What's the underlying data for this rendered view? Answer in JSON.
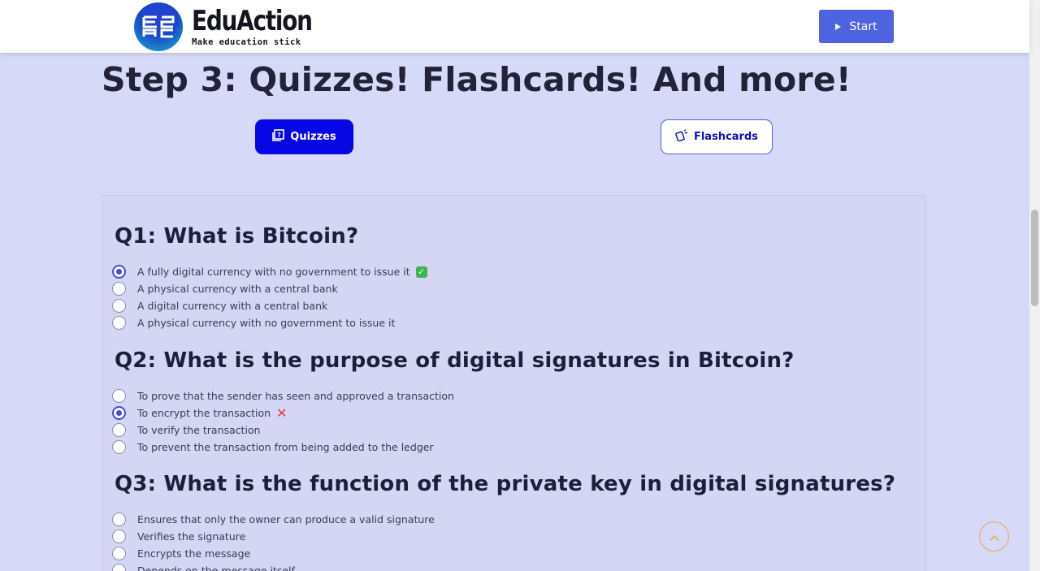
{
  "header": {
    "brand": "EduAction",
    "tagline": "Make education stick",
    "start_label": "Start"
  },
  "step": {
    "title": "Step 3: Quizzes! Flashcards! And more!"
  },
  "tabs": {
    "quizzes_label": "Quizzes",
    "flashcards_label": "Flashcards"
  },
  "quiz": {
    "questions": [
      {
        "title": "Q1: What is Bitcoin?",
        "options": [
          {
            "label": "A fully digital currency with no government to issue it",
            "selected": true,
            "result": "correct"
          },
          {
            "label": "A physical currency with a central bank",
            "selected": false
          },
          {
            "label": "A digital currency with a central bank",
            "selected": false
          },
          {
            "label": "A physical currency with no government to issue it",
            "selected": false
          }
        ]
      },
      {
        "title": "Q2: What is the purpose of digital signatures in Bitcoin?",
        "options": [
          {
            "label": "To prove that the sender has seen and approved a transaction",
            "selected": false
          },
          {
            "label": "To encrypt the transaction",
            "selected": true,
            "result": "incorrect"
          },
          {
            "label": "To verify the transaction",
            "selected": false
          },
          {
            "label": "To prevent the transaction from being added to the ledger",
            "selected": false
          }
        ]
      },
      {
        "title": "Q3: What is the function of the private key in digital signatures?",
        "options": [
          {
            "label": "Ensures that only the owner can produce a valid signature",
            "selected": false
          },
          {
            "label": "Verifies the signature",
            "selected": false
          },
          {
            "label": "Encrypts the message",
            "selected": false
          },
          {
            "label": "Depends on the message itself",
            "selected": false
          }
        ]
      }
    ]
  },
  "colors": {
    "background": "#d6d9f8",
    "primary": "#0707e6",
    "start_button": "#4e63e0",
    "correct": "#3ab84a",
    "incorrect": "#e53935"
  },
  "icons": {
    "start": "play-icon",
    "quizzes": "quiz-icon",
    "flashcards": "flashcards-icon",
    "back_to_top": "chevron-up-icon"
  }
}
